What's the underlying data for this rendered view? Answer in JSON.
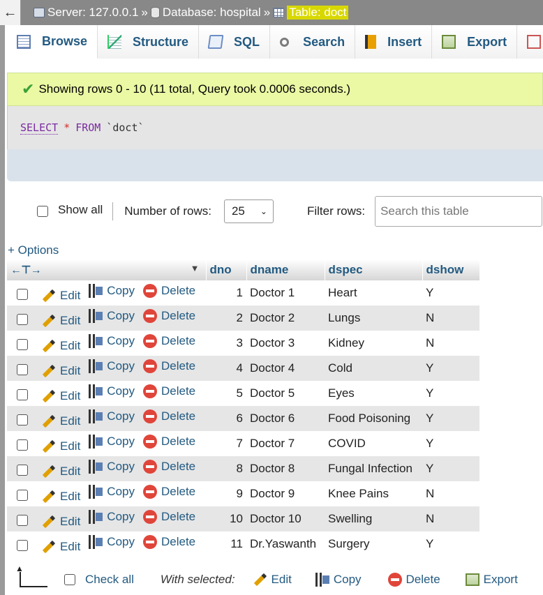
{
  "breadcrumb": {
    "back": "←",
    "server": "Server: 127.0.0.1",
    "database": "Database: hospital",
    "table": "Table: doct",
    "separator": "»"
  },
  "tabs": [
    "Browse",
    "Structure",
    "SQL",
    "Search",
    "Insert",
    "Export"
  ],
  "message": "Showing rows 0 - 10 (11 total, Query took 0.0006 seconds.)",
  "sql": {
    "select": "SELECT",
    "star": "*",
    "from": "FROM",
    "table": "`doct`"
  },
  "controls": {
    "show_all": "Show all",
    "num_rows_label": "Number of rows:",
    "num_rows_value": "25",
    "filter_label": "Filter rows:",
    "filter_placeholder": "Search this table"
  },
  "options_link": "+ Options",
  "table": {
    "columns": [
      "dno",
      "dname",
      "dspec",
      "dshow"
    ],
    "actions": {
      "edit": "Edit",
      "copy": "Copy",
      "delete": "Delete"
    },
    "rows": [
      [
        "1",
        "Doctor 1",
        "Heart",
        "Y"
      ],
      [
        "2",
        "Doctor 2",
        "Lungs",
        "N"
      ],
      [
        "3",
        "Doctor 3",
        "Kidney",
        "N"
      ],
      [
        "4",
        "Doctor 4",
        "Cold",
        "Y"
      ],
      [
        "5",
        "Doctor 5",
        "Eyes",
        "Y"
      ],
      [
        "6",
        "Doctor 6",
        "Food Poisoning",
        "Y"
      ],
      [
        "7",
        "Doctor 7",
        "COVID",
        "Y"
      ],
      [
        "8",
        "Doctor 8",
        "Fungal Infection",
        "Y"
      ],
      [
        "9",
        "Doctor 9",
        "Knee Pains",
        "N"
      ],
      [
        "10",
        "Doctor 10",
        "Swelling",
        "N"
      ],
      [
        "11",
        "Dr.Yaswanth",
        "Surgery",
        "Y"
      ]
    ]
  },
  "footer": {
    "check_all": "Check all",
    "with_selected": "With selected:",
    "edit": "Edit",
    "copy": "Copy",
    "delete": "Delete",
    "export": "Export"
  }
}
